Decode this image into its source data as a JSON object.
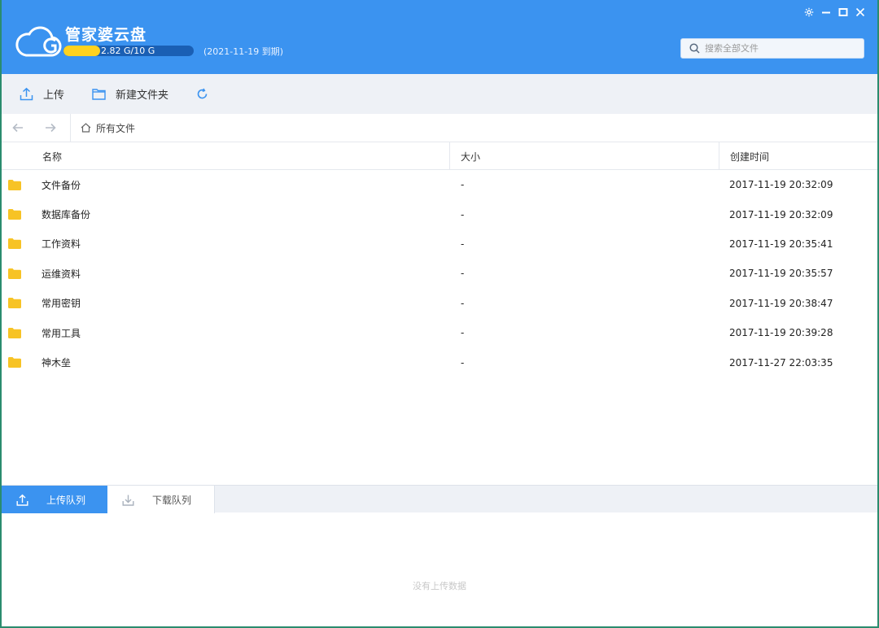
{
  "app": {
    "title": "管家婆云盘",
    "quota_text": "2.82 G/10 G",
    "quota_used_fraction": 0.282,
    "expire_text": "(2021-11-19 到期)"
  },
  "window_controls": {
    "settings_icon": "gear-icon",
    "minimize_icon": "minimize-icon",
    "maximize_icon": "maximize-icon",
    "close_icon": "close-icon"
  },
  "search": {
    "placeholder": "搜索全部文件",
    "value": ""
  },
  "toolbar": {
    "upload_label": "上传",
    "new_folder_label": "新建文件夹"
  },
  "nav": {
    "breadcrumb_label": "所有文件"
  },
  "table": {
    "headers": {
      "name": "名称",
      "size": "大小",
      "created": "创建时间"
    },
    "rows": [
      {
        "name": "文件备份",
        "size": "-",
        "created": "2017-11-19 20:32:09"
      },
      {
        "name": "数据库备份",
        "size": "-",
        "created": "2017-11-19 20:32:09"
      },
      {
        "name": "工作资料",
        "size": "-",
        "created": "2017-11-19 20:35:41"
      },
      {
        "name": "运维资料",
        "size": "-",
        "created": "2017-11-19 20:35:57"
      },
      {
        "name": "常用密钥",
        "size": "-",
        "created": "2017-11-19 20:38:47"
      },
      {
        "name": "常用工具",
        "size": "-",
        "created": "2017-11-19 20:39:28"
      },
      {
        "name": "神木垒",
        "size": "-",
        "created": "2017-11-27 22:03:35"
      }
    ]
  },
  "queue": {
    "upload_tab": "上传队列",
    "download_tab": "下载队列",
    "empty_message": "没有上传数据"
  },
  "colors": {
    "header_blue": "#3b93f0",
    "quota_yellow": "#ffd21f",
    "folder_yellow": "#f7c325",
    "toolbar_icon_blue": "#3b93f0"
  }
}
